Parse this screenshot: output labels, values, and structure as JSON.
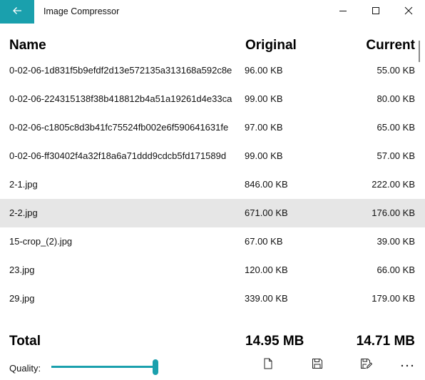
{
  "window": {
    "title": "Image Compressor",
    "accent": "#1aa0ad",
    "back_icon": "back-arrow-icon",
    "minimize_icon": "minimize-icon",
    "maximize_icon": "maximize-icon",
    "close_icon": "close-icon"
  },
  "header": {
    "name": "Name",
    "original": "Original",
    "current": "Current"
  },
  "files": [
    {
      "name": "0-02-06-1d831f5b9efdf2d13e572135a313168a592c8e",
      "original": "96.00 KB",
      "current": "55.00 KB",
      "selected": false
    },
    {
      "name": "0-02-06-224315138f38b418812b4a51a19261d4e33ca",
      "original": "99.00 KB",
      "current": "80.00 KB",
      "selected": false
    },
    {
      "name": "0-02-06-c1805c8d3b41fc75524fb002e6f590641631fe",
      "original": "97.00 KB",
      "current": "65.00 KB",
      "selected": false
    },
    {
      "name": "0-02-06-ff30402f4a32f18a6a71ddd9cdcb5fd171589d",
      "original": "99.00 KB",
      "current": "57.00 KB",
      "selected": false
    },
    {
      "name": "2-1.jpg",
      "original": "846.00 KB",
      "current": "222.00 KB",
      "selected": false
    },
    {
      "name": "2-2.jpg",
      "original": "671.00 KB",
      "current": "176.00 KB",
      "selected": true
    },
    {
      "name": "15-crop_(2).jpg",
      "original": "67.00 KB",
      "current": "39.00 KB",
      "selected": false
    },
    {
      "name": "23.jpg",
      "original": "120.00 KB",
      "current": "66.00 KB",
      "selected": false
    },
    {
      "name": "29.jpg",
      "original": "339.00 KB",
      "current": "179.00 KB",
      "selected": false
    }
  ],
  "total": {
    "label": "Total",
    "original": "14.95 MB",
    "current": "14.71 MB"
  },
  "quality": {
    "label": "Quality:",
    "value_fraction": 0.97
  },
  "toolbar": {
    "new_icon": "new-document-icon",
    "save_icon": "save-icon",
    "save_as_icon": "save-as-icon",
    "more_icon": "more-ellipsis-icon",
    "more_label": "..."
  }
}
